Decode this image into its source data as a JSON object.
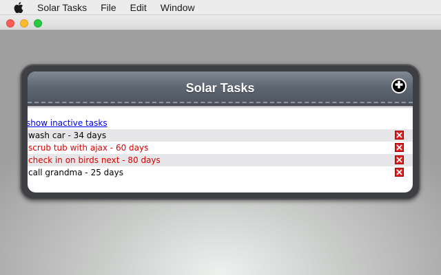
{
  "menubar": {
    "apple_icon": "apple-icon",
    "items": [
      "Solar Tasks",
      "File",
      "Edit",
      "Window"
    ]
  },
  "app": {
    "title": "Solar Tasks",
    "add_icon": "plus-circle-icon",
    "show_inactive_label": "show inactive tasks",
    "tasks": [
      {
        "text": "wash car - 34 days",
        "color": "#000000"
      },
      {
        "text": "scrub tub with ajax - 60 days",
        "color": "#e00000"
      },
      {
        "text": "check in on birds next - 80 days",
        "color": "#e00000"
      },
      {
        "text": "call grandma - 25 days",
        "color": "#000000"
      }
    ],
    "delete_icon": "delete-x-icon"
  },
  "colors": {
    "header_top": "#808894",
    "header_bottom": "#4b525d",
    "overdue": "#e00000",
    "link": "#0000ee",
    "delete": "#e02020"
  }
}
